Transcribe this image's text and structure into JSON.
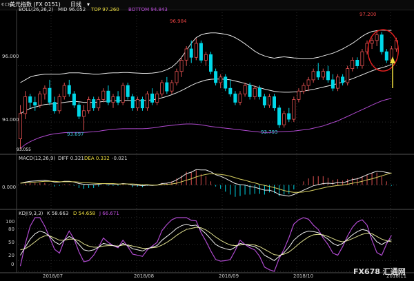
{
  "header": {
    "symbol_code": "€CN",
    "symbol_name": "美元指数 (FX 0151)",
    "period": "日线",
    "period_arrow": "▾"
  },
  "panels": {
    "price": {
      "indicator": "BOLL(26,26,2)",
      "mid_label": "MID 96.052",
      "top_label": "TOP 97.260",
      "bottom_label": "BOTTOM 94.843",
      "y_ticks": [
        "96.000",
        "94.000"
      ],
      "low_corner_label": "93.055",
      "annotations": [
        "96.984",
        "93.697",
        "93.793",
        "97.200"
      ]
    },
    "macd": {
      "indicator": "MACD(12,26,9)",
      "diff_label": "DIFF 0.321",
      "dea_label": "DEA 0.332",
      "hist_label": "-0.021",
      "y_ticks": [
        "0.000"
      ]
    },
    "kdj": {
      "indicator": "KDJ(9,3,3)",
      "k_label": "K 58.663",
      "d_label": "D 54.658",
      "j_label": "J 66.671",
      "y_ticks": [
        "100",
        "80",
        "50",
        "20",
        "0"
      ]
    }
  },
  "x_axis_labels": [
    "2018/07",
    "2018/08",
    "2018/09",
    "2018/10",
    "2018/11"
  ],
  "watermark": "FX678 汇通网",
  "colors": {
    "up": "#e05050",
    "down": "#00d8e8",
    "boll_line": "#e8e8e8",
    "boll_bottom": "#b04ad0",
    "annotation_red": "#e04040",
    "annotation_cyan": "#40c8e0",
    "arrow": "#f0e040",
    "circle": "#e02020"
  },
  "chart_data": {
    "type": "candlestick",
    "price_range": [
      92.9,
      97.9
    ],
    "candles": [
      {
        "o": 93.4,
        "h": 94.6,
        "l": 93.05,
        "c": 94.3
      },
      {
        "o": 94.3,
        "h": 95.1,
        "l": 94.1,
        "c": 94.9
      },
      {
        "o": 94.9,
        "h": 95.0,
        "l": 94.5,
        "c": 94.7
      },
      {
        "o": 94.7,
        "h": 94.9,
        "l": 94.4,
        "c": 94.6
      },
      {
        "o": 94.6,
        "h": 95.1,
        "l": 94.5,
        "c": 95.0
      },
      {
        "o": 95.0,
        "h": 95.3,
        "l": 94.8,
        "c": 95.2
      },
      {
        "o": 95.2,
        "h": 95.5,
        "l": 94.6,
        "c": 94.7
      },
      {
        "o": 94.7,
        "h": 94.9,
        "l": 94.3,
        "c": 94.4
      },
      {
        "o": 94.4,
        "h": 95.0,
        "l": 94.3,
        "c": 94.9
      },
      {
        "o": 94.9,
        "h": 95.4,
        "l": 94.8,
        "c": 95.3
      },
      {
        "o": 95.3,
        "h": 95.5,
        "l": 94.9,
        "c": 95.0
      },
      {
        "o": 95.0,
        "h": 95.1,
        "l": 94.5,
        "c": 94.6
      },
      {
        "o": 94.6,
        "h": 94.7,
        "l": 94.1,
        "c": 94.2
      },
      {
        "o": 94.2,
        "h": 94.6,
        "l": 93.7,
        "c": 94.4
      },
      {
        "o": 94.4,
        "h": 94.9,
        "l": 94.3,
        "c": 94.8
      },
      {
        "o": 94.8,
        "h": 94.9,
        "l": 94.4,
        "c": 94.5
      },
      {
        "o": 94.5,
        "h": 94.9,
        "l": 94.4,
        "c": 94.8
      },
      {
        "o": 94.8,
        "h": 95.2,
        "l": 94.7,
        "c": 95.1
      },
      {
        "o": 95.1,
        "h": 95.3,
        "l": 94.6,
        "c": 94.7
      },
      {
        "o": 94.7,
        "h": 95.0,
        "l": 94.5,
        "c": 94.9
      },
      {
        "o": 94.9,
        "h": 95.1,
        "l": 94.6,
        "c": 94.7
      },
      {
        "o": 94.7,
        "h": 95.4,
        "l": 94.6,
        "c": 95.3
      },
      {
        "o": 95.3,
        "h": 95.4,
        "l": 94.8,
        "c": 94.9
      },
      {
        "o": 94.9,
        "h": 95.0,
        "l": 94.4,
        "c": 94.5
      },
      {
        "o": 94.5,
        "h": 94.9,
        "l": 94.4,
        "c": 94.8
      },
      {
        "o": 94.8,
        "h": 94.9,
        "l": 94.4,
        "c": 94.5
      },
      {
        "o": 94.5,
        "h": 95.1,
        "l": 94.4,
        "c": 95.0
      },
      {
        "o": 95.0,
        "h": 95.2,
        "l": 94.6,
        "c": 94.7
      },
      {
        "o": 94.7,
        "h": 95.1,
        "l": 94.6,
        "c": 95.0
      },
      {
        "o": 95.0,
        "h": 95.5,
        "l": 94.9,
        "c": 95.4
      },
      {
        "o": 95.4,
        "h": 95.6,
        "l": 95.0,
        "c": 95.1
      },
      {
        "o": 95.1,
        "h": 95.5,
        "l": 95.0,
        "c": 95.4
      },
      {
        "o": 95.4,
        "h": 95.9,
        "l": 95.3,
        "c": 95.8
      },
      {
        "o": 95.8,
        "h": 96.3,
        "l": 95.6,
        "c": 96.2
      },
      {
        "o": 96.2,
        "h": 96.7,
        "l": 96.0,
        "c": 96.6
      },
      {
        "o": 96.6,
        "h": 96.9,
        "l": 96.1,
        "c": 96.3
      },
      {
        "o": 96.3,
        "h": 96.98,
        "l": 96.2,
        "c": 96.8
      },
      {
        "o": 96.8,
        "h": 96.9,
        "l": 96.1,
        "c": 96.2
      },
      {
        "o": 96.2,
        "h": 96.5,
        "l": 96.0,
        "c": 96.4
      },
      {
        "o": 96.4,
        "h": 96.5,
        "l": 95.7,
        "c": 95.8
      },
      {
        "o": 95.8,
        "h": 95.9,
        "l": 95.3,
        "c": 95.4
      },
      {
        "o": 95.4,
        "h": 95.7,
        "l": 95.2,
        "c": 95.6
      },
      {
        "o": 95.6,
        "h": 95.7,
        "l": 95.1,
        "c": 95.2
      },
      {
        "o": 95.2,
        "h": 95.5,
        "l": 94.9,
        "c": 95.0
      },
      {
        "o": 95.0,
        "h": 95.1,
        "l": 94.6,
        "c": 94.7
      },
      {
        "o": 94.7,
        "h": 95.1,
        "l": 94.6,
        "c": 95.0
      },
      {
        "o": 95.0,
        "h": 95.4,
        "l": 94.9,
        "c": 95.3
      },
      {
        "o": 95.3,
        "h": 95.4,
        "l": 94.8,
        "c": 94.9
      },
      {
        "o": 94.9,
        "h": 95.3,
        "l": 94.8,
        "c": 95.2
      },
      {
        "o": 95.2,
        "h": 95.3,
        "l": 94.8,
        "c": 94.9
      },
      {
        "o": 94.9,
        "h": 95.0,
        "l": 94.5,
        "c": 94.6
      },
      {
        "o": 94.6,
        "h": 95.0,
        "l": 94.5,
        "c": 94.9
      },
      {
        "o": 94.9,
        "h": 95.0,
        "l": 94.4,
        "c": 94.5
      },
      {
        "o": 94.5,
        "h": 94.6,
        "l": 93.79,
        "c": 93.9
      },
      {
        "o": 93.9,
        "h": 94.4,
        "l": 93.8,
        "c": 94.3
      },
      {
        "o": 94.3,
        "h": 94.5,
        "l": 94.0,
        "c": 94.1
      },
      {
        "o": 94.1,
        "h": 94.9,
        "l": 94.0,
        "c": 94.8
      },
      {
        "o": 94.8,
        "h": 95.2,
        "l": 94.7,
        "c": 95.1
      },
      {
        "o": 95.1,
        "h": 95.4,
        "l": 95.0,
        "c": 95.3
      },
      {
        "o": 95.3,
        "h": 95.6,
        "l": 95.1,
        "c": 95.5
      },
      {
        "o": 95.5,
        "h": 95.9,
        "l": 95.4,
        "c": 95.8
      },
      {
        "o": 95.8,
        "h": 96.1,
        "l": 95.5,
        "c": 95.6
      },
      {
        "o": 95.6,
        "h": 95.9,
        "l": 95.5,
        "c": 95.8
      },
      {
        "o": 95.8,
        "h": 96.0,
        "l": 95.4,
        "c": 95.5
      },
      {
        "o": 95.5,
        "h": 95.7,
        "l": 95.1,
        "c": 95.2
      },
      {
        "o": 95.2,
        "h": 95.7,
        "l": 95.1,
        "c": 95.6
      },
      {
        "o": 95.6,
        "h": 95.7,
        "l": 95.3,
        "c": 95.4
      },
      {
        "o": 95.4,
        "h": 96.0,
        "l": 95.3,
        "c": 95.9
      },
      {
        "o": 95.9,
        "h": 96.3,
        "l": 95.8,
        "c": 96.2
      },
      {
        "o": 96.2,
        "h": 96.3,
        "l": 95.9,
        "c": 96.0
      },
      {
        "o": 96.0,
        "h": 96.6,
        "l": 95.9,
        "c": 96.5
      },
      {
        "o": 96.5,
        "h": 96.9,
        "l": 96.4,
        "c": 96.8
      },
      {
        "o": 96.8,
        "h": 97.0,
        "l": 96.6,
        "c": 96.9
      },
      {
        "o": 96.9,
        "h": 97.2,
        "l": 96.7,
        "c": 97.1
      },
      {
        "o": 97.1,
        "h": 97.2,
        "l": 96.4,
        "c": 96.5
      },
      {
        "o": 96.5,
        "h": 96.6,
        "l": 96.1,
        "c": 96.2
      },
      {
        "o": 96.2,
        "h": 96.7,
        "l": 96.1,
        "c": 96.6
      },
      {
        "o": 96.6,
        "h": 97.0,
        "l": 96.5,
        "c": 96.9
      }
    ],
    "boll": {
      "top": [
        95.4,
        95.5,
        95.6,
        95.65,
        95.68,
        95.7,
        95.7,
        95.7,
        95.7,
        95.72,
        95.75,
        95.75,
        95.75,
        95.73,
        95.72,
        95.7,
        95.7,
        95.72,
        95.74,
        95.75,
        95.75,
        95.76,
        95.76,
        95.75,
        95.74,
        95.73,
        95.73,
        95.74,
        95.76,
        95.8,
        95.86,
        95.95,
        96.1,
        96.3,
        96.55,
        96.8,
        97.0,
        97.1,
        97.15,
        97.17,
        97.17,
        97.15,
        97.12,
        97.08,
        97.0,
        96.9,
        96.78,
        96.65,
        96.52,
        96.42,
        96.35,
        96.3,
        96.27,
        96.3,
        96.32,
        96.3,
        96.28,
        96.27,
        96.26,
        96.26,
        96.27,
        96.3,
        96.35,
        96.4,
        96.45,
        96.52,
        96.6,
        96.7,
        96.8,
        96.92,
        97.05,
        97.15,
        97.22,
        97.25,
        97.27,
        97.26,
        97.26
      ],
      "mid": [
        94.3,
        94.4,
        94.48,
        94.53,
        94.58,
        94.62,
        94.64,
        94.65,
        94.67,
        94.7,
        94.72,
        94.73,
        94.72,
        94.7,
        94.7,
        94.7,
        94.71,
        94.73,
        94.74,
        94.75,
        94.76,
        94.77,
        94.77,
        94.76,
        94.76,
        94.76,
        94.77,
        94.79,
        94.82,
        94.86,
        94.91,
        94.97,
        95.04,
        95.12,
        95.21,
        95.3,
        95.38,
        95.44,
        95.49,
        95.52,
        95.53,
        95.53,
        95.52,
        95.5,
        95.46,
        95.42,
        95.37,
        95.32,
        95.27,
        95.22,
        95.17,
        95.13,
        95.09,
        95.07,
        95.06,
        95.06,
        95.07,
        95.08,
        95.1,
        95.13,
        95.16,
        95.2,
        95.24,
        95.28,
        95.32,
        95.37,
        95.42,
        95.48,
        95.54,
        95.61,
        95.68,
        95.75,
        95.82,
        95.88,
        95.93,
        95.98,
        96.05
      ],
      "bottom": [
        93.05,
        93.2,
        93.3,
        93.38,
        93.45,
        93.5,
        93.55,
        93.58,
        93.6,
        93.62,
        93.63,
        93.63,
        93.63,
        93.63,
        93.64,
        93.65,
        93.67,
        93.7,
        93.72,
        93.74,
        93.75,
        93.76,
        93.76,
        93.76,
        93.76,
        93.76,
        93.77,
        93.79,
        93.81,
        93.84,
        93.86,
        93.88,
        93.9,
        93.92,
        93.93,
        93.93,
        93.92,
        93.9,
        93.87,
        93.84,
        93.82,
        93.8,
        93.78,
        93.76,
        93.74,
        93.72,
        93.7,
        93.68,
        93.66,
        93.64,
        93.63,
        93.63,
        93.64,
        93.65,
        93.66,
        93.67,
        93.68,
        93.7,
        93.72,
        93.74,
        93.78,
        93.82,
        93.86,
        93.92,
        93.98,
        94.04,
        94.12,
        94.2,
        94.28,
        94.36,
        94.44,
        94.52,
        94.6,
        94.68,
        94.75,
        94.8,
        94.84
      ]
    },
    "macd": {
      "range": [
        -0.55,
        0.65
      ],
      "diff": [
        0.05,
        0.08,
        0.1,
        0.11,
        0.12,
        0.13,
        0.11,
        0.08,
        0.08,
        0.1,
        0.1,
        0.08,
        0.04,
        0.02,
        0.02,
        0.01,
        0.02,
        0.04,
        0.03,
        0.03,
        0.02,
        0.04,
        0.03,
        0.0,
        0.0,
        -0.02,
        0.0,
        -0.01,
        0.0,
        0.04,
        0.05,
        0.08,
        0.14,
        0.22,
        0.31,
        0.35,
        0.42,
        0.41,
        0.41,
        0.36,
        0.28,
        0.24,
        0.18,
        0.11,
        0.04,
        0.01,
        0.0,
        -0.04,
        -0.06,
        -0.1,
        -0.14,
        -0.14,
        -0.18,
        -0.26,
        -0.28,
        -0.3,
        -0.26,
        -0.2,
        -0.14,
        -0.08,
        -0.02,
        0.01,
        0.04,
        0.05,
        0.04,
        0.07,
        0.06,
        0.1,
        0.15,
        0.17,
        0.22,
        0.28,
        0.33,
        0.38,
        0.37,
        0.34,
        0.32
      ],
      "dea": [
        0.05,
        0.06,
        0.07,
        0.08,
        0.09,
        0.1,
        0.1,
        0.1,
        0.09,
        0.09,
        0.09,
        0.09,
        0.08,
        0.07,
        0.06,
        0.05,
        0.04,
        0.04,
        0.04,
        0.04,
        0.03,
        0.03,
        0.03,
        0.03,
        0.02,
        0.01,
        0.01,
        0.0,
        0.0,
        0.01,
        0.02,
        0.03,
        0.05,
        0.09,
        0.13,
        0.17,
        0.22,
        0.26,
        0.29,
        0.31,
        0.3,
        0.29,
        0.27,
        0.24,
        0.2,
        0.16,
        0.13,
        0.09,
        0.06,
        0.02,
        -0.01,
        -0.04,
        -0.07,
        -0.11,
        -0.15,
        -0.18,
        -0.2,
        -0.2,
        -0.19,
        -0.17,
        -0.14,
        -0.11,
        -0.08,
        -0.05,
        -0.03,
        -0.01,
        0.0,
        0.02,
        0.05,
        0.07,
        0.1,
        0.14,
        0.17,
        0.21,
        0.25,
        0.29,
        0.33
      ]
    },
    "kdj": {
      "range": [
        0,
        100
      ],
      "k": [
        30,
        45,
        60,
        70,
        75,
        72,
        65,
        55,
        50,
        58,
        65,
        60,
        50,
        40,
        38,
        40,
        45,
        52,
        50,
        48,
        46,
        52,
        48,
        42,
        40,
        38,
        42,
        45,
        48,
        58,
        65,
        72,
        80,
        85,
        88,
        85,
        86,
        78,
        70,
        60,
        50,
        45,
        42,
        40,
        45,
        52,
        50,
        48,
        46,
        40,
        30,
        25,
        20,
        28,
        35,
        45,
        58,
        66,
        72,
        75,
        74,
        72,
        66,
        60,
        52,
        48,
        52,
        60,
        68,
        74,
        78,
        76,
        66,
        55,
        50,
        55,
        59
      ],
      "d": [
        40,
        42,
        48,
        55,
        62,
        66,
        66,
        62,
        58,
        58,
        60,
        60,
        57,
        51,
        47,
        45,
        45,
        47,
        48,
        48,
        47,
        49,
        49,
        47,
        45,
        43,
        43,
        44,
        45,
        49,
        54,
        60,
        67,
        73,
        78,
        80,
        82,
        81,
        77,
        71,
        64,
        58,
        53,
        49,
        48,
        49,
        50,
        50,
        49,
        46,
        41,
        36,
        31,
        30,
        32,
        36,
        43,
        51,
        58,
        64,
        68,
        69,
        68,
        65,
        61,
        57,
        55,
        57,
        61,
        65,
        69,
        71,
        70,
        65,
        60,
        57,
        55
      ],
      "j": [
        10,
        51,
        84,
        100,
        100,
        84,
        63,
        41,
        34,
        58,
        75,
        60,
        36,
        18,
        20,
        30,
        45,
        62,
        54,
        48,
        44,
        58,
        46,
        32,
        30,
        28,
        40,
        47,
        54,
        76,
        87,
        96,
        100,
        100,
        100,
        95,
        94,
        72,
        56,
        38,
        22,
        19,
        20,
        22,
        39,
        58,
        50,
        44,
        40,
        28,
        8,
        3,
        0,
        24,
        41,
        63,
        88,
        96,
        100,
        97,
        86,
        78,
        62,
        50,
        34,
        30,
        46,
        66,
        82,
        92,
        96,
        86,
        58,
        35,
        30,
        51,
        67
      ]
    }
  }
}
